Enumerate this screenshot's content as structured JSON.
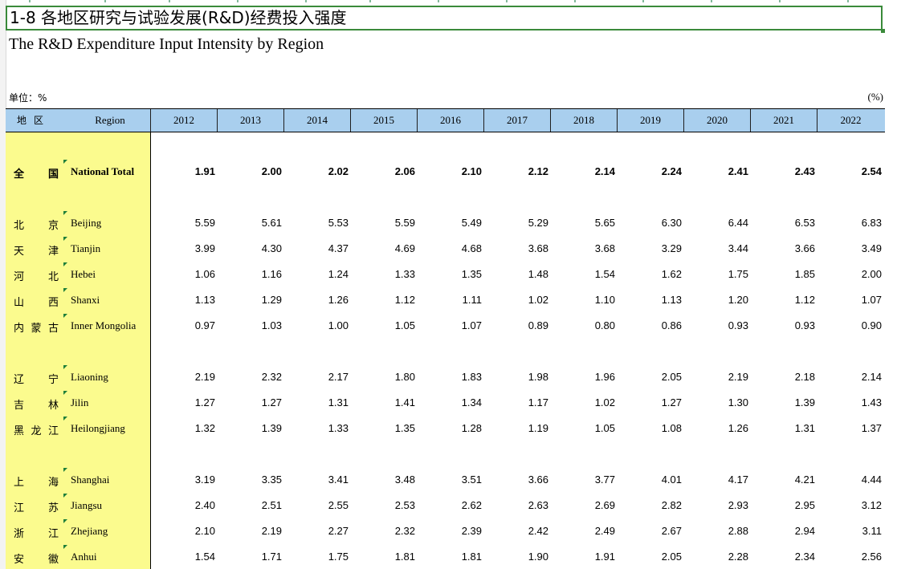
{
  "sheet": {
    "title": "1-8  各地区研究与试验发展(R&D)经费投入强度",
    "subtitle": "The R&D Expenditure Input Intensity by Region",
    "unit_label": "单位：%",
    "unit_symbol": "(%)"
  },
  "header": {
    "region_cn": "地区",
    "region_en": "Region",
    "years": [
      "2012",
      "2013",
      "2014",
      "2015",
      "2016",
      "2017",
      "2018",
      "2019",
      "2020",
      "2021",
      "2022"
    ]
  },
  "rows": [
    {
      "cn": [
        "全",
        "国"
      ],
      "en": "National Total",
      "total": true,
      "values": [
        "1.91",
        "2.00",
        "2.02",
        "2.06",
        "2.10",
        "2.12",
        "2.14",
        "2.24",
        "2.41",
        "2.43",
        "2.54"
      ]
    },
    {
      "cn": [
        "北",
        "京"
      ],
      "en": "Beijing",
      "values": [
        "5.59",
        "5.61",
        "5.53",
        "5.59",
        "5.49",
        "5.29",
        "5.65",
        "6.30",
        "6.44",
        "6.53",
        "6.83"
      ]
    },
    {
      "cn": [
        "天",
        "津"
      ],
      "en": "Tianjin",
      "values": [
        "3.99",
        "4.30",
        "4.37",
        "4.69",
        "4.68",
        "3.68",
        "3.68",
        "3.29",
        "3.44",
        "3.66",
        "3.49"
      ]
    },
    {
      "cn": [
        "河",
        "北"
      ],
      "en": "Hebei",
      "values": [
        "1.06",
        "1.16",
        "1.24",
        "1.33",
        "1.35",
        "1.48",
        "1.54",
        "1.62",
        "1.75",
        "1.85",
        "2.00"
      ]
    },
    {
      "cn": [
        "山",
        "西"
      ],
      "en": "Shanxi",
      "values": [
        "1.13",
        "1.29",
        "1.26",
        "1.12",
        "1.11",
        "1.02",
        "1.10",
        "1.13",
        "1.20",
        "1.12",
        "1.07"
      ]
    },
    {
      "cn": [
        "内",
        "蒙",
        "古"
      ],
      "en": "Inner Mongolia",
      "values": [
        "0.97",
        "1.03",
        "1.00",
        "1.05",
        "1.07",
        "0.89",
        "0.80",
        "0.86",
        "0.93",
        "0.93",
        "0.90"
      ]
    },
    {
      "cn": [
        "辽",
        "宁"
      ],
      "en": "Liaoning",
      "values": [
        "2.19",
        "2.32",
        "2.17",
        "1.80",
        "1.83",
        "1.98",
        "1.96",
        "2.05",
        "2.19",
        "2.18",
        "2.14"
      ]
    },
    {
      "cn": [
        "吉",
        "林"
      ],
      "en": "Jilin",
      "values": [
        "1.27",
        "1.27",
        "1.31",
        "1.41",
        "1.34",
        "1.17",
        "1.02",
        "1.27",
        "1.30",
        "1.39",
        "1.43"
      ]
    },
    {
      "cn": [
        "黑",
        "龙",
        "江"
      ],
      "en": "Heilongjiang",
      "values": [
        "1.32",
        "1.39",
        "1.33",
        "1.35",
        "1.28",
        "1.19",
        "1.05",
        "1.08",
        "1.26",
        "1.31",
        "1.37"
      ]
    },
    {
      "cn": [
        "上",
        "海"
      ],
      "en": "Shanghai",
      "values": [
        "3.19",
        "3.35",
        "3.41",
        "3.48",
        "3.51",
        "3.66",
        "3.77",
        "4.01",
        "4.17",
        "4.21",
        "4.44"
      ]
    },
    {
      "cn": [
        "江",
        "苏"
      ],
      "en": "Jiangsu",
      "values": [
        "2.40",
        "2.51",
        "2.55",
        "2.53",
        "2.62",
        "2.63",
        "2.69",
        "2.82",
        "2.93",
        "2.95",
        "3.12"
      ]
    },
    {
      "cn": [
        "浙",
        "江"
      ],
      "en": "Zhejiang",
      "values": [
        "2.10",
        "2.19",
        "2.27",
        "2.32",
        "2.39",
        "2.42",
        "2.49",
        "2.67",
        "2.88",
        "2.94",
        "3.11"
      ]
    },
    {
      "cn": [
        "安",
        "徽"
      ],
      "en": "Anhui",
      "values": [
        "1.54",
        "1.71",
        "1.75",
        "1.81",
        "1.81",
        "1.90",
        "1.91",
        "2.05",
        "2.28",
        "2.34",
        "2.56"
      ]
    }
  ]
}
